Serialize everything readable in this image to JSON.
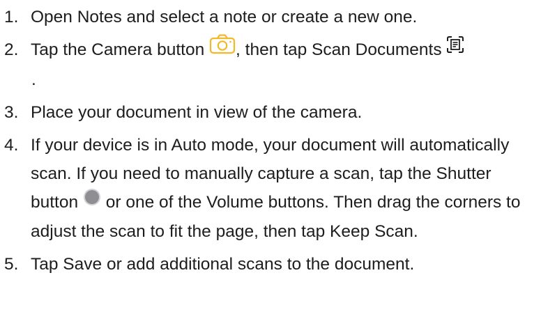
{
  "instructions": {
    "steps": [
      {
        "number": "1.",
        "text": "Open Notes and select a note or create a new one."
      },
      {
        "number": "2.",
        "text_before_camera": "Tap the Camera button ",
        "text_between": ", then tap Scan Documents ",
        "text_after": "."
      },
      {
        "number": "3.",
        "text": "Place your document in view of the camera."
      },
      {
        "number": "4.",
        "text_before_shutter": "If your device is in Auto mode, your document will automatically scan. If you need to manually capture a scan, tap the Shutter button ",
        "text_after_shutter": " or one of the Volume buttons. Then drag the corners to adjust the scan to fit the page, then tap Keep Scan."
      },
      {
        "number": "5.",
        "text": "Tap Save or add additional scans to the document."
      }
    ]
  },
  "icons": {
    "camera": "camera-icon",
    "scan_documents": "scan-documents-icon",
    "shutter": "shutter-icon"
  },
  "colors": {
    "text": "#1d1d1f",
    "camera_icon": "#f2b92b",
    "shutter_icon": "#8e8e93"
  }
}
